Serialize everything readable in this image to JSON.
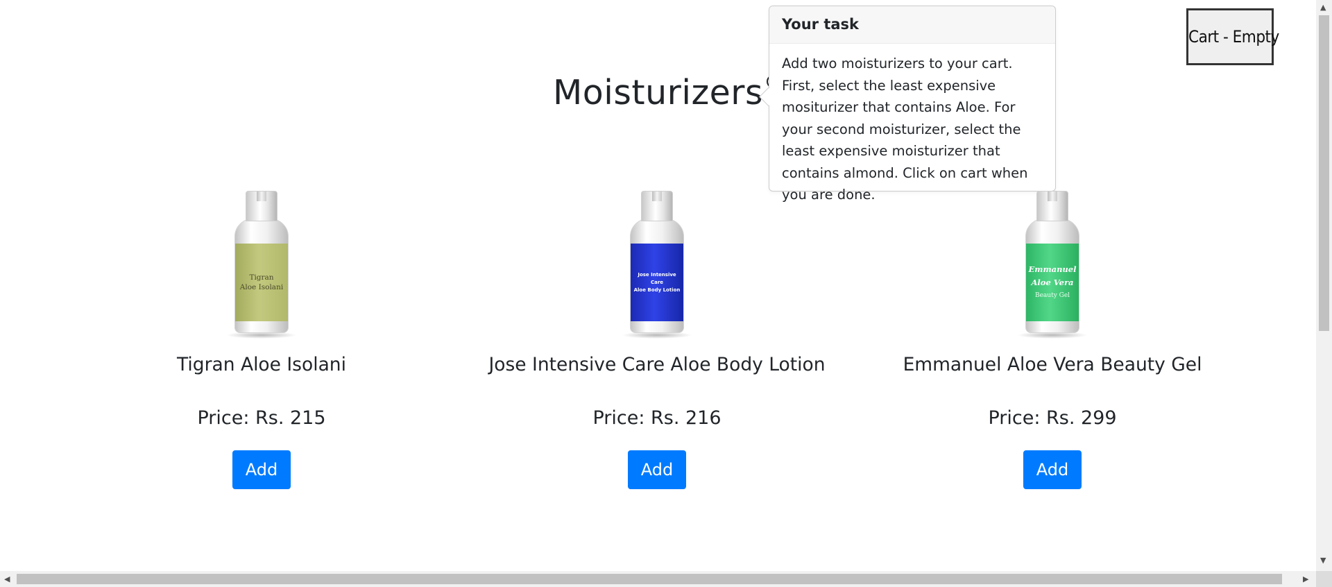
{
  "page": {
    "title": "Moisturizers"
  },
  "cart": {
    "label": "Cart - Empty"
  },
  "task_popover": {
    "header": "Your task",
    "body": "Add two moisturizers to your cart. First, select the least expensive mositurizer that contains Aloe. For your second moisturizer, select the least expensive moisturizer that contains almond. Click on cart when you are done."
  },
  "products": [
    {
      "name": "Tigran Aloe Isolani",
      "price": "Price: Rs. 215",
      "add_label": "Add",
      "bottle": {
        "label_lines": [
          "Tigran",
          "Aloe Isolani"
        ],
        "color": "#b5bb6c"
      }
    },
    {
      "name": "Jose Intensive Care Aloe Body Lotion",
      "price": "Price: Rs. 216",
      "add_label": "Add",
      "bottle": {
        "label_lines": [
          "Jose Intensive Care",
          "Aloe Body Lotion"
        ],
        "color": "#2233cc"
      }
    },
    {
      "name": "Emmanuel Aloe Vera Beauty Gel",
      "price": "Price: Rs. 299",
      "add_label": "Add",
      "bottle": {
        "label_lines": [
          "Emmanuel",
          "Aloe Vera",
          "Beauty Gel"
        ],
        "color": "#3cc774"
      }
    }
  ],
  "icons": {
    "info": "info-circle-icon",
    "scroll_up": "triangle-up",
    "scroll_down": "triangle-down",
    "scroll_left": "triangle-left",
    "scroll_right": "triangle-right"
  },
  "colors": {
    "accent": "#007bff"
  }
}
